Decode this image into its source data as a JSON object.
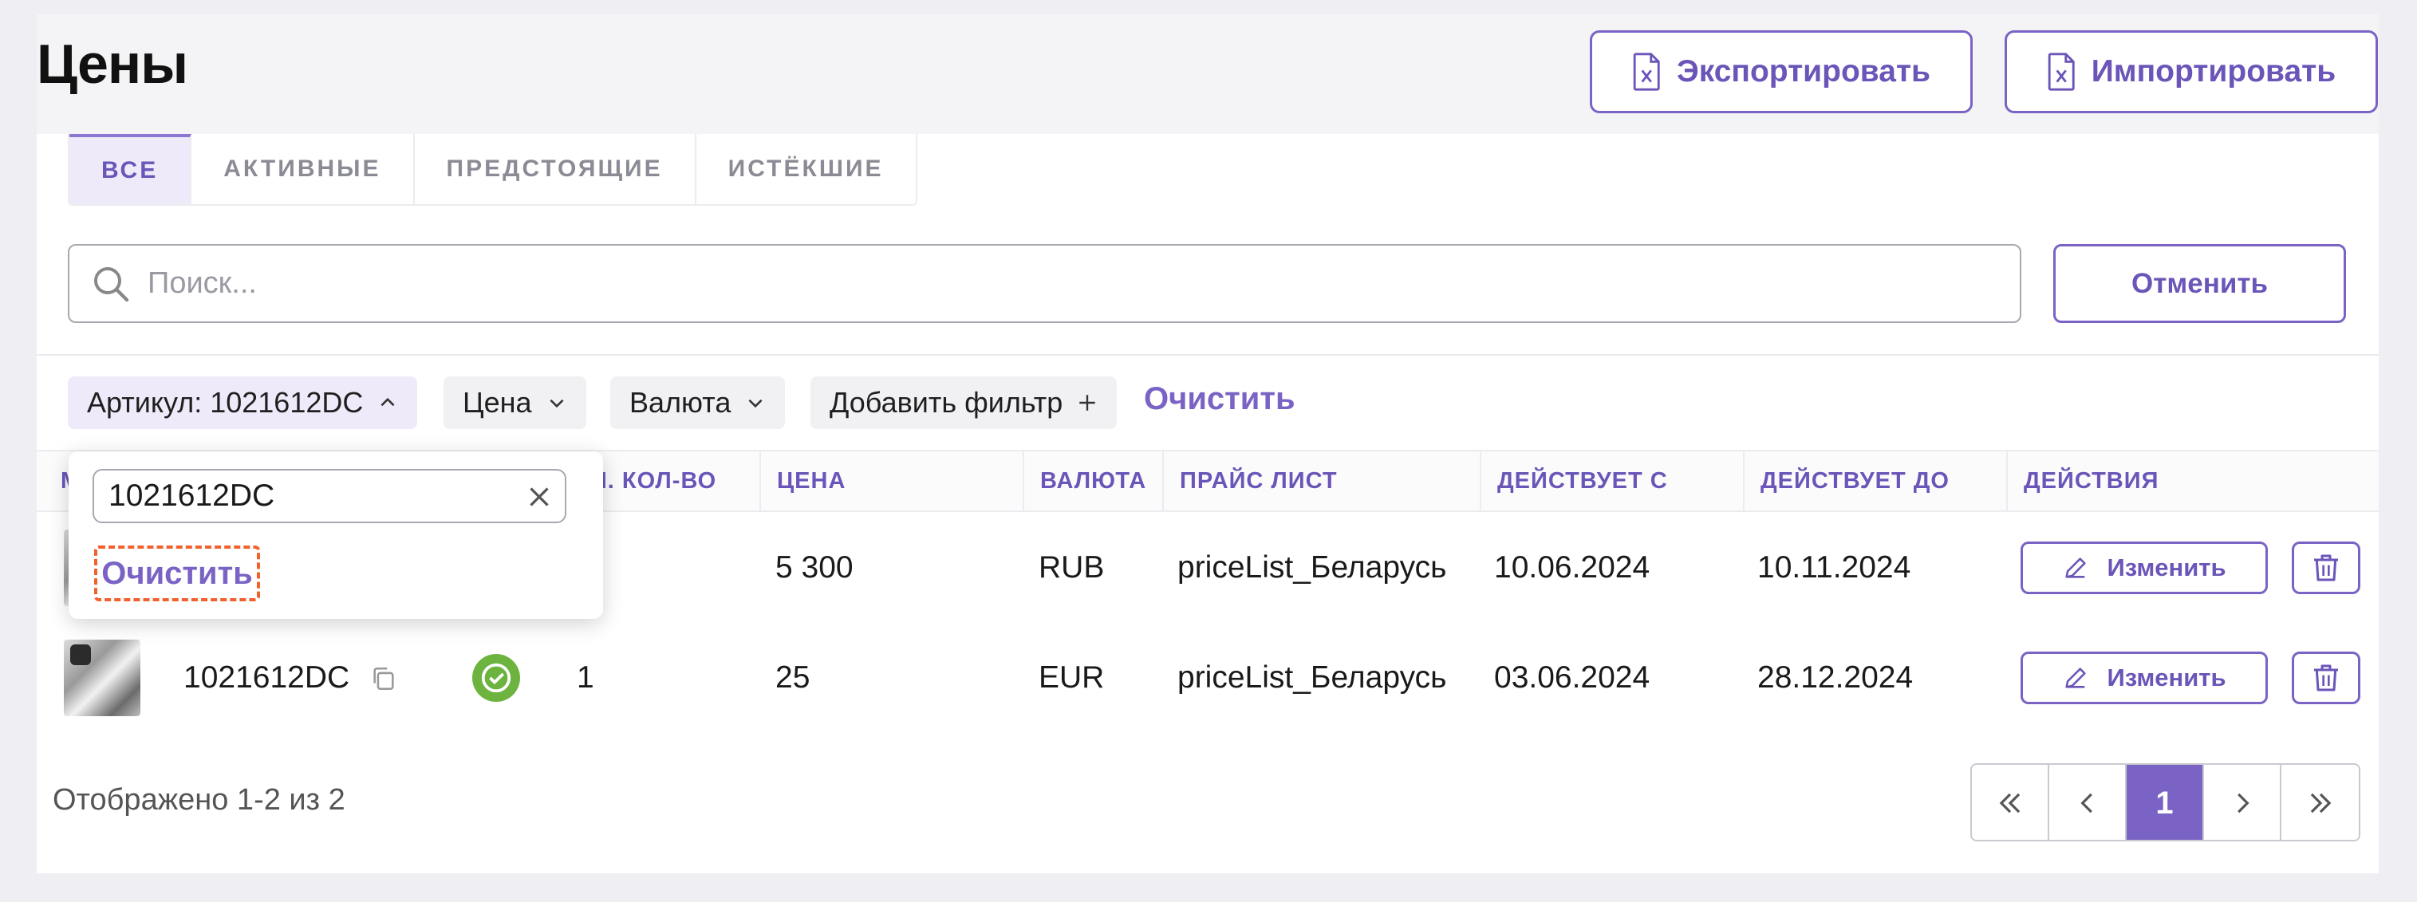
{
  "header": {
    "title": "Цены",
    "export_label": "Экспортировать",
    "import_label": "Импортировать"
  },
  "tabs": [
    {
      "label": "ВСЕ",
      "active": true
    },
    {
      "label": "АКТИВНЫЕ",
      "active": false
    },
    {
      "label": "ПРЕДСТОЯЩИЕ",
      "active": false
    },
    {
      "label": "ИСТЁКШИЕ",
      "active": false
    }
  ],
  "search": {
    "placeholder": "Поиск...",
    "value": "",
    "cancel_label": "Отменить"
  },
  "filters": {
    "chips": [
      {
        "label": "Артикул: 1021612DC",
        "icon": "chevron-up-icon",
        "active": true
      },
      {
        "label": "Цена",
        "icon": "chevron-down-icon",
        "active": false
      },
      {
        "label": "Валюта",
        "icon": "chevron-down-icon",
        "active": false
      },
      {
        "label": "Добавить фильтр",
        "icon": "plus-icon",
        "active": false
      }
    ],
    "clear_label": "Очистить"
  },
  "popup": {
    "input_value": "1021612DC",
    "clear_label": "Очистить"
  },
  "table": {
    "columns": [
      {
        "label": "М"
      },
      {
        "label": "ИН. КОЛ-ВО"
      },
      {
        "label": "ЦЕНА"
      },
      {
        "label": "ВАЛЮТА"
      },
      {
        "label": "ПРАЙС ЛИСТ"
      },
      {
        "label": "ДЕЙСТВУЕТ С"
      },
      {
        "label": "ДЕЙСТВУЕТ ДО"
      },
      {
        "label": "ДЕЙСТВИЯ"
      }
    ],
    "rows": [
      {
        "sku": "",
        "min_qty": "",
        "price": "5 300",
        "currency": "RUB",
        "price_list": "priceList_Беларусь",
        "valid_from": "10.06.2024",
        "valid_to": "10.11.2024",
        "edit_label": "Изменить"
      },
      {
        "sku": "1021612DC",
        "min_qty": "1",
        "price": "25",
        "currency": "EUR",
        "price_list": "priceList_Беларусь",
        "valid_from": "03.06.2024",
        "valid_to": "28.12.2024",
        "edit_label": "Изменить"
      }
    ]
  },
  "pagination": {
    "summary": "Отображено 1-2 из 2",
    "current_page": "1"
  },
  "colors": {
    "accent": "#7a63c4",
    "status_ok": "#6cb33f",
    "focus_outline": "#f0612d"
  }
}
